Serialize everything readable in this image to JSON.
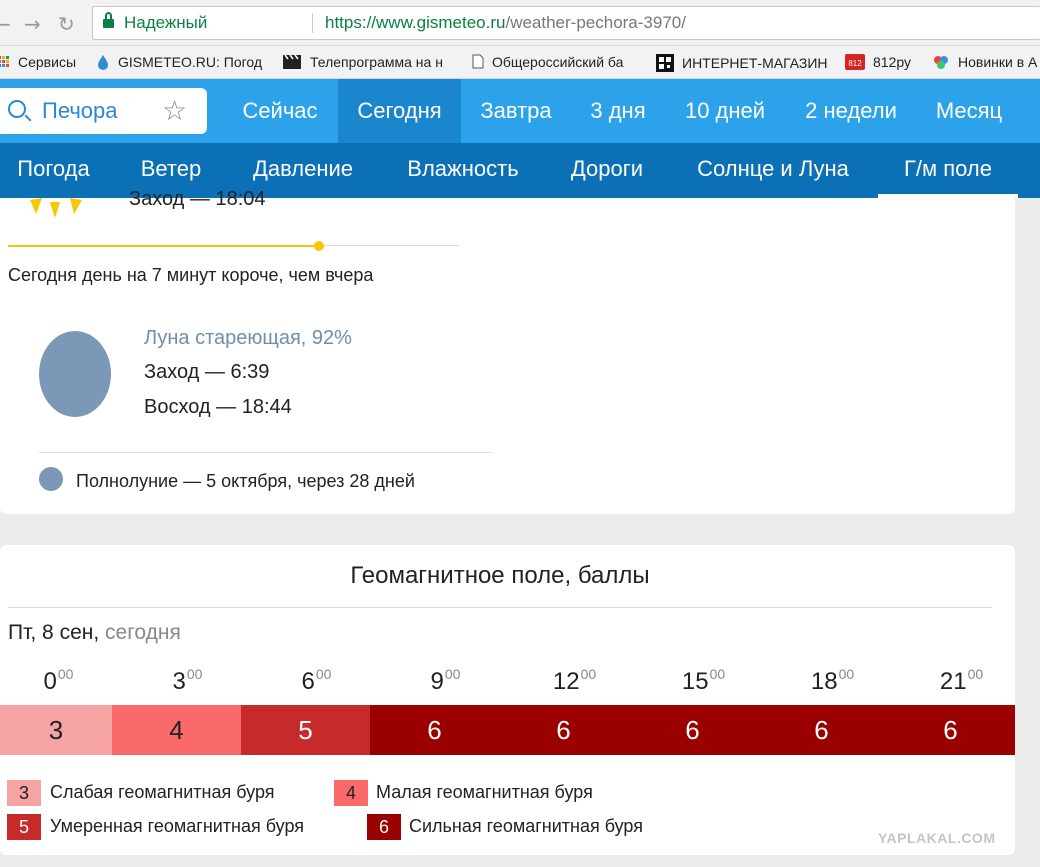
{
  "browser": {
    "security_label": "Надежный",
    "url_host": "https://www.gismeteo.ru",
    "url_path": "/weather-pechora-3970/"
  },
  "bookmarks": [
    {
      "label": "Сервисы",
      "icon": "apps-grid-icon"
    },
    {
      "label": "GISMETEO.RU: Погод",
      "icon": "drop-icon"
    },
    {
      "label": "Телепрограмма на н",
      "icon": "clapperboard-icon"
    },
    {
      "label": "Общероссийский ба",
      "icon": "document-icon"
    },
    {
      "label": "ИНТЕРНЕТ-МАГАЗИН",
      "icon": "qr-icon"
    },
    {
      "label": "812ру",
      "icon": "812-logo-icon"
    },
    {
      "label": "Новинки в А",
      "icon": "colorful-logo-icon"
    }
  ],
  "search": {
    "city": "Печора"
  },
  "top_tabs": [
    {
      "label": "Сейчас",
      "active": false
    },
    {
      "label": "Сегодня",
      "active": true
    },
    {
      "label": "Завтра",
      "active": false
    },
    {
      "label": "3 дня",
      "active": false
    },
    {
      "label": "10 дней",
      "active": false
    },
    {
      "label": "2 недели",
      "active": false
    },
    {
      "label": "Месяц",
      "active": false
    }
  ],
  "sub_tabs": [
    {
      "label": "Погода",
      "active": false
    },
    {
      "label": "Ветер",
      "active": false
    },
    {
      "label": "Давление",
      "active": false
    },
    {
      "label": "Влажность",
      "active": false
    },
    {
      "label": "Дороги",
      "active": false
    },
    {
      "label": "Солнце и Луна",
      "active": false
    },
    {
      "label": "Г/м поле",
      "active": true
    }
  ],
  "sun": {
    "sunset": "Заход — 18:04",
    "day_progress_percent": 69,
    "day_length_note": "Сегодня день на 7 минут короче, чем вчера"
  },
  "moon": {
    "phase": "Луна стареющая, 92%",
    "set": "Заход — 6:39",
    "rise": "Восход — 18:44",
    "full_moon": "Полнолуние — 5 октября, через 28 дней"
  },
  "geomagnetic": {
    "title": "Геомагнитное поле, баллы",
    "date": "Пт, 8 сен,",
    "date_today": "сегодня",
    "hours": [
      {
        "h": "0",
        "m": "00"
      },
      {
        "h": "3",
        "m": "00"
      },
      {
        "h": "6",
        "m": "00"
      },
      {
        "h": "9",
        "m": "00"
      },
      {
        "h": "12",
        "m": "00"
      },
      {
        "h": "15",
        "m": "00"
      },
      {
        "h": "18",
        "m": "00"
      },
      {
        "h": "21",
        "m": "00"
      }
    ],
    "values": [
      "3",
      "4",
      "5",
      "6",
      "6",
      "6",
      "6",
      "6"
    ],
    "level_colors": {
      "3": "#f6a3a3",
      "4": "#fb6a6a",
      "5": "#c62a2a",
      "6": "#9a0000"
    },
    "legend": [
      {
        "value": "3",
        "label": "Слабая геомагнитная буря"
      },
      {
        "value": "4",
        "label": "Малая геомагнитная буря"
      },
      {
        "value": "5",
        "label": "Умеренная геомагнитная буря"
      },
      {
        "value": "6",
        "label": "Сильная геомагнитная буря"
      }
    ]
  },
  "watermark": "YAPLAKAL.COM"
}
